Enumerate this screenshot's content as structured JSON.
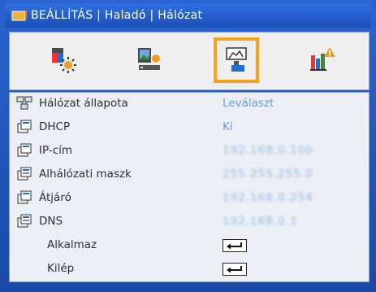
{
  "window": {
    "title": "BEÁLLÍTÁS | Haladó | Hálózat"
  },
  "tabs": [
    {
      "icon": "image-settings-icon",
      "active": false
    },
    {
      "icon": "display-settings-icon",
      "active": false
    },
    {
      "icon": "setup-settings-icon",
      "active": true
    },
    {
      "icon": "options-info-icon",
      "active": false
    }
  ],
  "menu": {
    "network_status": {
      "label": "Hálózat állapota",
      "value": "Leválaszt",
      "icon": "network-status-icon"
    },
    "dhcp": {
      "label": "DHCP",
      "value": "Ki",
      "icon": "dhcp-icon"
    },
    "ip": {
      "label": "IP-cím",
      "value": "192.168.0.100",
      "icon": "ip-address-icon"
    },
    "subnet": {
      "label": "Alhálózati maszk",
      "value": "255.255.255.0",
      "icon": "subnet-mask-icon"
    },
    "gateway": {
      "label": "Átjáró",
      "value": "192.168.0.254",
      "icon": "gateway-icon"
    },
    "dns": {
      "label": "DNS",
      "value": "192.168.0.1",
      "icon": "dns-icon"
    },
    "apply": {
      "label": "Alkalmaz",
      "icon": "enter-key-icon"
    },
    "exit": {
      "label": "Kilép",
      "icon": "enter-key-icon"
    }
  },
  "colors": {
    "accent": "#f7a11c",
    "frame": "#1b4fb5",
    "value_text": "#6f9ad9"
  }
}
